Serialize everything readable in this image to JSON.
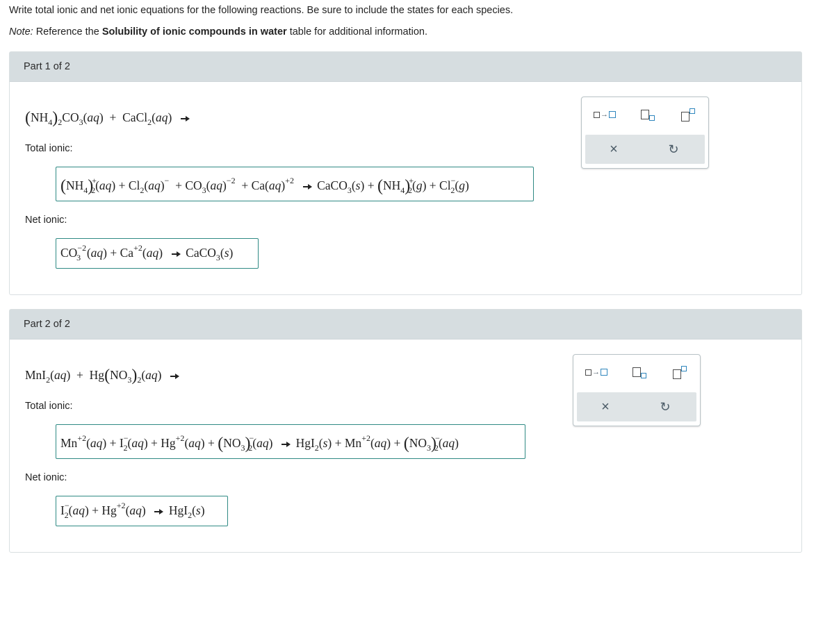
{
  "instructions": {
    "line1": "Write total ionic and net ionic equations for the following reactions. Be sure to include the states for each species.",
    "note_label": "Note:",
    "note_pre": " Reference the ",
    "note_bold": "Solubility of ionic compounds in water",
    "note_post": " table for additional information."
  },
  "part1": {
    "title": "Part 1 of 2",
    "total_label": "Total ionic:",
    "net_label": "Net ionic:"
  },
  "part2": {
    "title": "Part 2 of 2",
    "total_label": "Total ionic:",
    "net_label": "Net ionic:"
  },
  "symbols": {
    "plus": "+",
    "minus": "−",
    "neg": "−",
    "two": "2",
    "three": "3",
    "four": "4",
    "pos2": "+2",
    "neg2": "−2",
    "aq": "aq",
    "s": "s",
    "g": "g",
    "NH": "NH",
    "CO": "CO",
    "CaCl": "CaCl",
    "Cl": "Cl",
    "Ca": "Ca",
    "CaCO": "CaCO",
    "MnI": "MnI",
    "Hg": "Hg",
    "NO": "NO",
    "Mn": "Mn",
    "I": "I",
    "HgI": "HgI"
  },
  "toolbar": {
    "icons": [
      "reaction-arrow-icon",
      "subscript-icon",
      "superscript-icon",
      "clear-icon",
      "undo-icon"
    ],
    "clear_glyph": "×",
    "undo_glyph": "↻"
  },
  "colors": {
    "answer_border": "#2f8a84",
    "header_bg": "#d6dde0",
    "icon_blue": "#2f86bd"
  }
}
